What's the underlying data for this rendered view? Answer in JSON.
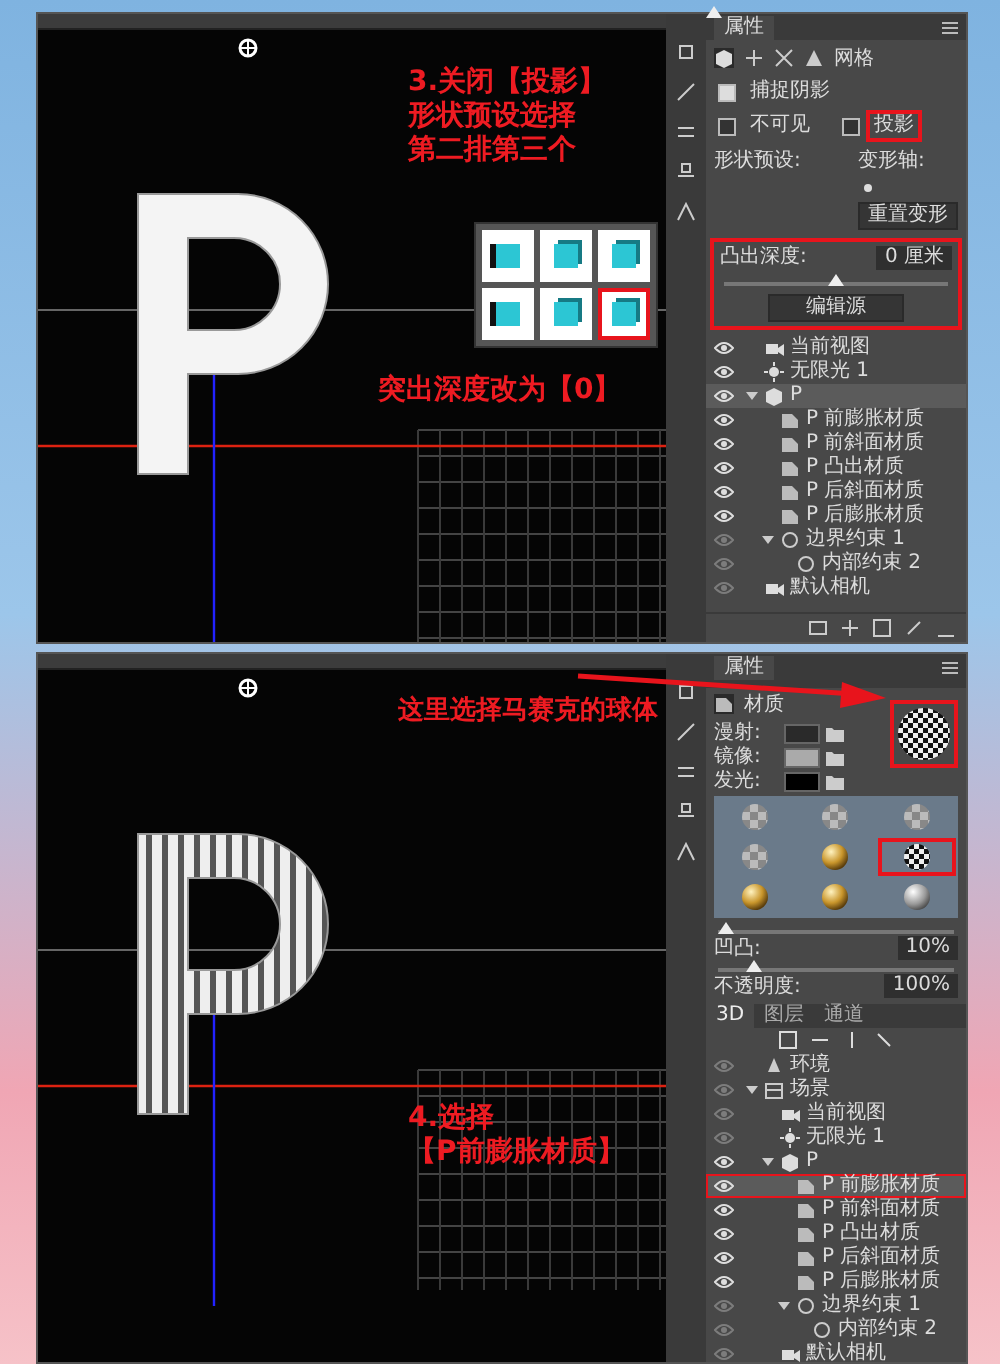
{
  "screenshots": [
    {
      "callouts": [
        {
          "lines": [
            "3.关闭【投影】",
            "形状预设选择",
            "第二排第三个"
          ]
        },
        {
          "lines": [
            "突出深度改为【0】"
          ]
        }
      ],
      "panel": {
        "kind": "mesh",
        "title": "属性",
        "mode_label": "网格",
        "options": [
          {
            "label": "捕捉阴影",
            "checked": true,
            "highlighted": false
          },
          {
            "label": "不可见",
            "checked": false,
            "highlighted": false
          },
          {
            "label": "投影",
            "checked": false,
            "highlighted": true
          }
        ],
        "preset_label": "形状预设:",
        "axis_label": "变形轴:",
        "reset_button": "重置变形",
        "presets": [
          {
            "selected": false
          },
          {
            "selected": false
          },
          {
            "selected": false
          },
          {
            "selected": false
          },
          {
            "selected": false
          },
          {
            "selected": true
          }
        ],
        "depth": {
          "label": "凸出深度:",
          "value": "0 厘米",
          "level": 0.5,
          "highlighted": true,
          "button": "编辑源"
        }
      },
      "layers": {
        "items": [
          {
            "kind": "camera",
            "label": "当前视图",
            "visible": true,
            "selected": false
          },
          {
            "kind": "light",
            "label": "无限光 1",
            "visible": true,
            "selected": false
          },
          {
            "kind": "mesh",
            "label": "P",
            "visible": true,
            "selected": true,
            "expanded": true,
            "children": [
              {
                "kind": "material",
                "label": "P 前膨胀材质",
                "visible": true,
                "selected": false
              },
              {
                "kind": "material",
                "label": "P 前斜面材质",
                "visible": true,
                "selected": false
              },
              {
                "kind": "material",
                "label": "P 凸出材质",
                "visible": true,
                "selected": false
              },
              {
                "kind": "material",
                "label": "P 后斜面材质",
                "visible": true,
                "selected": false
              },
              {
                "kind": "material",
                "label": "P 后膨胀材质",
                "visible": true,
                "selected": false
              },
              {
                "kind": "constraint",
                "label": "边界约束 1",
                "visible": false,
                "selected": false,
                "expanded": true,
                "children": [
                  {
                    "kind": "constraint",
                    "label": "内部约束 2",
                    "visible": false,
                    "selected": false
                  }
                ]
              }
            ]
          },
          {
            "kind": "camera",
            "label": "默认相机",
            "visible": false,
            "selected": false
          }
        ]
      }
    },
    {
      "callouts": [
        {
          "lines": [
            "这里选择马赛克的球体"
          ]
        },
        {
          "lines": [
            "4.选择",
            "【P前膨胀材质】"
          ]
        }
      ],
      "panel": {
        "kind": "material",
        "title": "属性",
        "mode_label": "材质",
        "channels": [
          {
            "label": "漫射:"
          },
          {
            "label": "镜像:"
          },
          {
            "label": "发光:"
          }
        ],
        "thumbnail": {
          "kind": "mosaic",
          "highlighted": true
        },
        "materials": [
          {
            "kind": "checker",
            "selected": false
          },
          {
            "kind": "checker",
            "selected": false
          },
          {
            "kind": "checker",
            "selected": false
          },
          {
            "kind": "checker",
            "selected": false
          },
          {
            "kind": "gold",
            "selected": false
          },
          {
            "kind": "mosaic",
            "selected": true
          },
          {
            "kind": "gold",
            "selected": false
          },
          {
            "kind": "gold",
            "selected": false
          },
          {
            "kind": "silver",
            "selected": false
          }
        ],
        "sliders": [
          {
            "label": "凹凸:",
            "value": "10%",
            "level": 0.03
          },
          {
            "label": "不透明度:",
            "value": "100%",
            "level": 0.15
          }
        ]
      },
      "layers": {
        "tabs": [
          {
            "label": "3D",
            "selected": true
          },
          {
            "label": "图层",
            "selected": false
          },
          {
            "label": "通道",
            "selected": false
          }
        ],
        "items": [
          {
            "kind": "environment",
            "label": "环境",
            "visible": false,
            "selected": false
          },
          {
            "kind": "scene",
            "label": "场景",
            "visible": false,
            "selected": false,
            "expanded": true,
            "children": [
              {
                "kind": "camera",
                "label": "当前视图",
                "visible": false,
                "selected": false
              },
              {
                "kind": "light",
                "label": "无限光 1",
                "visible": false,
                "selected": false
              },
              {
                "kind": "mesh",
                "label": "P",
                "visible": true,
                "selected": false,
                "expanded": true,
                "children": [
                  {
                    "kind": "material",
                    "label": "P 前膨胀材质",
                    "visible": true,
                    "selected": true,
                    "highlighted": true
                  },
                  {
                    "kind": "material",
                    "label": "P 前斜面材质",
                    "visible": true,
                    "selected": false
                  },
                  {
                    "kind": "material",
                    "label": "P 凸出材质",
                    "visible": true,
                    "selected": false
                  },
                  {
                    "kind": "material",
                    "label": "P 后斜面材质",
                    "visible": true,
                    "selected": false
                  },
                  {
                    "kind": "material",
                    "label": "P 后膨胀材质",
                    "visible": true,
                    "selected": false
                  },
                  {
                    "kind": "constraint",
                    "label": "边界约束 1",
                    "visible": false,
                    "selected": false,
                    "expanded": true,
                    "children": [
                      {
                        "kind": "constraint",
                        "label": "内部约束 2",
                        "visible": false,
                        "selected": false
                      }
                    ]
                  }
                ]
              },
              {
                "kind": "camera",
                "label": "默认相机",
                "visible": false,
                "selected": false
              }
            ]
          }
        ]
      }
    }
  ]
}
